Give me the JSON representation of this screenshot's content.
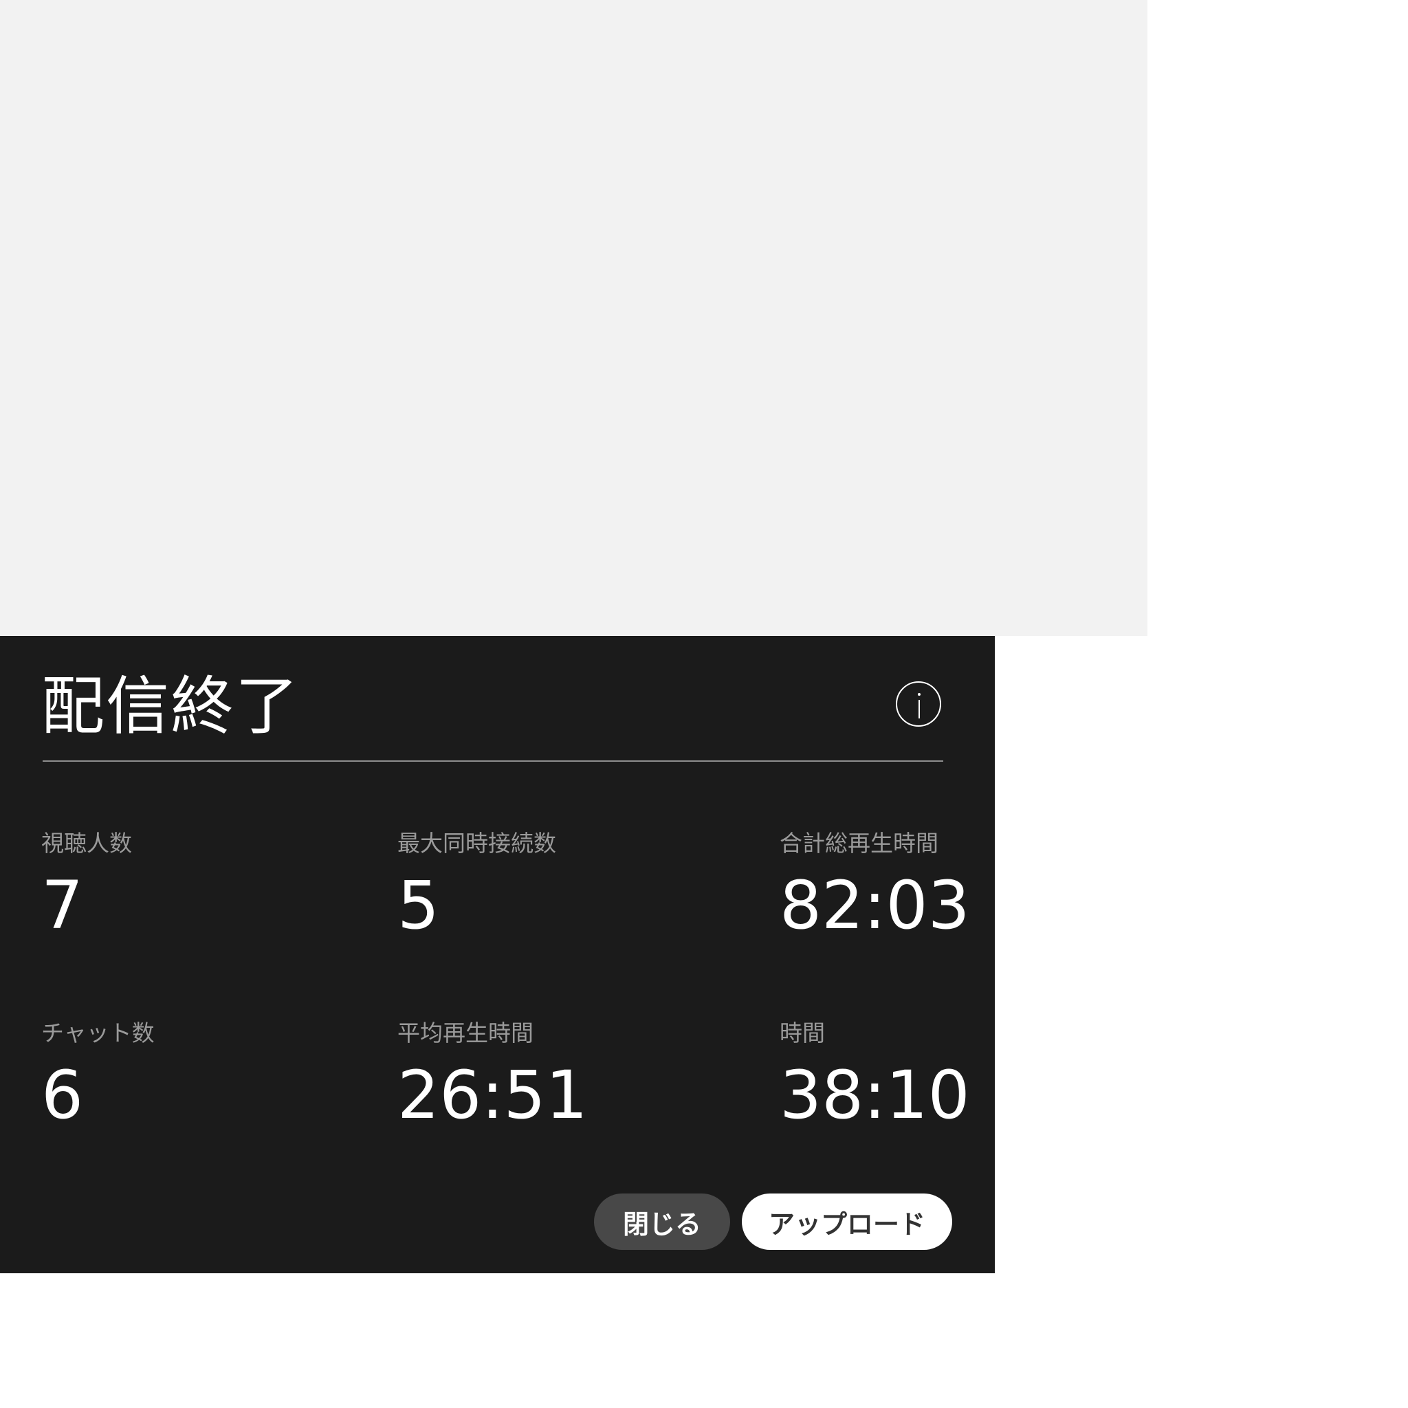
{
  "dialog": {
    "title": "配信終了",
    "info_icon": "info-icon"
  },
  "stats": [
    {
      "label": "視聴人数",
      "value": "7"
    },
    {
      "label": "最大同時接続数",
      "value": "5"
    },
    {
      "label": "合計総再生時間",
      "value": "82:03"
    },
    {
      "label": "チャット数",
      "value": "6"
    },
    {
      "label": "平均再生時間",
      "value": "26:51"
    },
    {
      "label": "時間",
      "value": "38:10"
    }
  ],
  "buttons": {
    "close_label": "閉じる",
    "upload_label": "アップロード"
  },
  "colors": {
    "panel_background": "#1b1b1b",
    "preview_background": "#f2f2f2",
    "label_gray": "#9a9a9a",
    "close_button": "#484848",
    "upload_button": "#ffffff"
  }
}
